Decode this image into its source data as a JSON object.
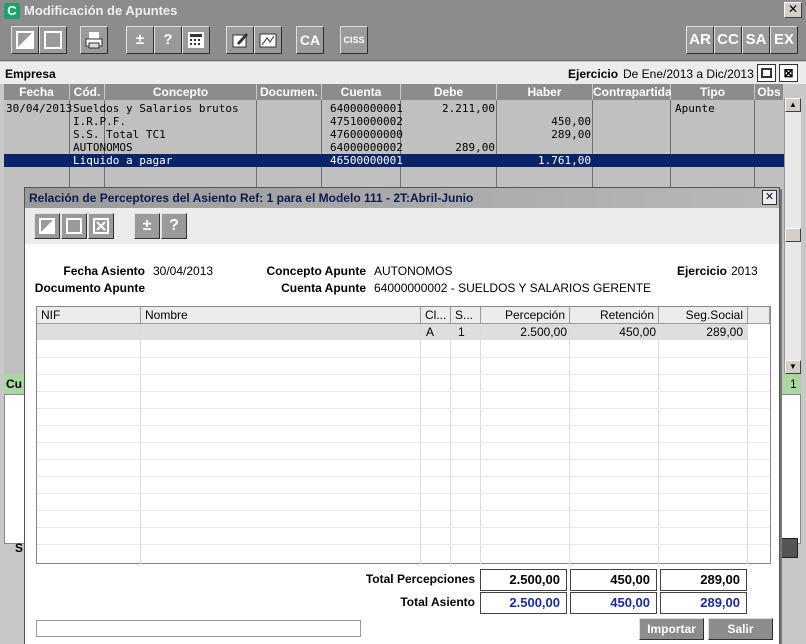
{
  "main_window": {
    "title": "Modificación de Apuntes",
    "app_icon_letter": "C",
    "close_glyph": "✕"
  },
  "toolbar": {
    "buttons": [
      {
        "name": "edit-record-icon"
      },
      {
        "name": "new-record-icon"
      },
      {
        "name": "print-icon"
      },
      {
        "name": "plus-minus-icon",
        "label": "±"
      },
      {
        "name": "help-icon",
        "label": "?"
      },
      {
        "name": "calculator-icon"
      },
      {
        "name": "document-edit-icon"
      },
      {
        "name": "map-icon"
      },
      {
        "name": "ca-button",
        "label": "CA"
      },
      {
        "name": "ciss-button",
        "label": "CISS"
      },
      {
        "name": "ar-button",
        "label": "AR"
      },
      {
        "name": "cc-button",
        "label": "CC"
      },
      {
        "name": "sa-button",
        "label": "SA"
      },
      {
        "name": "ex-button",
        "label": "EX"
      }
    ]
  },
  "empresa_bar": {
    "empresa_label": "Empresa",
    "ejercicio_label": "Ejercicio",
    "ejercicio_value": "De Ene/2013 a Dic/2013"
  },
  "ledger": {
    "columns": [
      "Fecha",
      "Cód.",
      "Concepto",
      "Documen.",
      "Cuenta",
      "Debe",
      "Haber",
      "Contrapartida",
      "Tipo",
      "Obs"
    ],
    "rows": [
      {
        "fecha": "30/04/2013",
        "concepto": "Sueldos y Salarios brutos",
        "cuenta": "64000000001",
        "debe": "2.211,00",
        "haber": "",
        "tipo": "Apunte"
      },
      {
        "fecha": "",
        "concepto": "I.R.P.F.",
        "cuenta": "47510000002",
        "debe": "",
        "haber": "450,00",
        "tipo": ""
      },
      {
        "fecha": "",
        "concepto": "S.S. Total TC1",
        "cuenta": "47600000000",
        "debe": "",
        "haber": "289,00",
        "tipo": ""
      },
      {
        "fecha": "",
        "concepto": "AUTONOMOS",
        "cuenta": "64000000002",
        "debe": "289,00",
        "haber": "",
        "tipo": ""
      },
      {
        "fecha": "",
        "concepto": "Liquido a pagar",
        "cuenta": "46500000001",
        "debe": "",
        "haber": "1.761,00",
        "tipo": ""
      }
    ],
    "selected_row": 4
  },
  "green_bar": {
    "left_text": "Cu",
    "right_text": "1"
  },
  "lower_area": {
    "left_text": "S"
  },
  "dialog": {
    "title": "Relación de Perceptores del Asiento Ref:     1  para el Modelo 111 - 2T:Abril-Junio",
    "close_glyph": "✕",
    "toolbar": [
      {
        "name": "edit-record-icon"
      },
      {
        "name": "new-record-icon"
      },
      {
        "name": "delete-record-icon"
      },
      {
        "name": "plus-minus-icon",
        "label": "±"
      },
      {
        "name": "help-icon",
        "label": "?"
      }
    ],
    "info": {
      "fecha_asiento_label": "Fecha Asiento",
      "fecha_asiento_value": "30/04/2013",
      "concepto_apunte_label": "Concepto Apunte",
      "concepto_apunte_value": "AUTONOMOS",
      "ejercicio_label": "Ejercicio",
      "ejercicio_value": "2013",
      "documento_apunte_label": "Documento Apunte",
      "cuenta_apunte_label": "Cuenta Apunte",
      "cuenta_apunte_value": "64000000002 - SUELDOS Y SALARIOS GERENTE"
    },
    "grid": {
      "columns": [
        "NIF",
        "Nombre",
        "Cl...",
        "S...",
        "Percepción",
        "Retención",
        "Seg.Social"
      ],
      "rows": [
        {
          "nif": "",
          "nombre": "",
          "cl": "A",
          "s": "1",
          "percepcion": "2.500,00",
          "retencion": "450,00",
          "seg_social": "289,00"
        }
      ]
    },
    "totals": {
      "percepciones_label": "Total Percepciones",
      "percepciones": [
        "2.500,00",
        "450,00",
        "289,00"
      ],
      "asiento_label": "Total Asiento",
      "asiento": [
        "2.500,00",
        "450,00",
        "289,00"
      ]
    },
    "buttons": {
      "importar": "Importar",
      "salir": "Salir"
    }
  }
}
